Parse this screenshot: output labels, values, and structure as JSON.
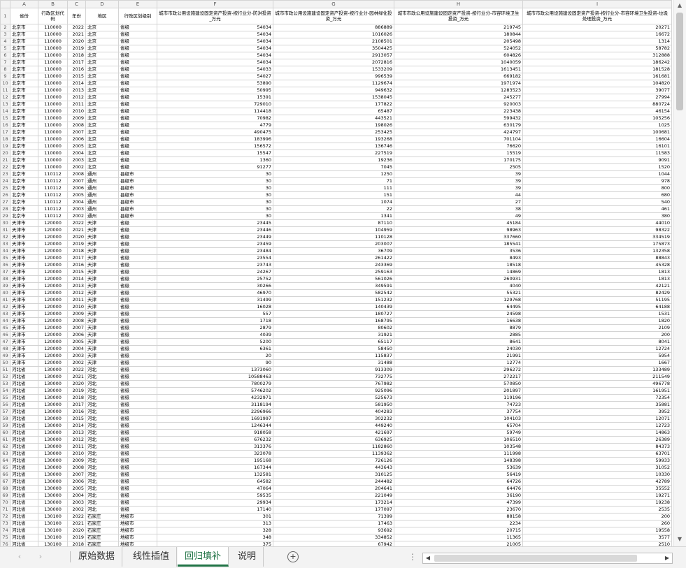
{
  "columns": [
    "A",
    "B",
    "C",
    "D",
    "E",
    "F",
    "G",
    "H",
    "I"
  ],
  "headers": [
    "省份",
    "行政区划代码",
    "年份",
    "地区",
    "行政区划级别",
    "城市市政公用设施建设固定资产投资-按行业分-防洪投资_万元",
    "城市市政公用设施建设固定资产投资-按行业分-园林绿化投资_万元",
    "城市市政公用设施建设固定资产投资-按行业分-市容环境卫生投资_万元",
    "城市市政公用设施建设固定资产投资-按行业分-市容环境卫生投资-垃圾处理投资_万元"
  ],
  "rows": [
    [
      "北京市",
      "110000",
      "2022",
      "北京",
      "省级",
      "54034",
      "886889",
      "219745",
      "20271"
    ],
    [
      "北京市",
      "110000",
      "2021",
      "北京",
      "省级",
      "54034",
      "1016026",
      "180844",
      "16672"
    ],
    [
      "北京市",
      "110000",
      "2020",
      "北京",
      "省级",
      "54034",
      "2108501",
      "205498",
      "1314"
    ],
    [
      "北京市",
      "110000",
      "2019",
      "北京",
      "省级",
      "54034",
      "3504425",
      "524052",
      "58782"
    ],
    [
      "北京市",
      "110000",
      "2018",
      "北京",
      "省级",
      "54034",
      "2913057",
      "604826",
      "312888"
    ],
    [
      "北京市",
      "110000",
      "2017",
      "北京",
      "省级",
      "54034",
      "2072816",
      "1040059",
      "186242"
    ],
    [
      "北京市",
      "110000",
      "2016",
      "北京",
      "省级",
      "54033",
      "1533209",
      "1613451",
      "181528"
    ],
    [
      "北京市",
      "110000",
      "2015",
      "北京",
      "省级",
      "54027",
      "996539",
      "669182",
      "161681"
    ],
    [
      "北京市",
      "110000",
      "2014",
      "北京",
      "省级",
      "53890",
      "1129674",
      "1971974",
      "104820"
    ],
    [
      "北京市",
      "110000",
      "2013",
      "北京",
      "省级",
      "50995",
      "949632",
      "1283523",
      "39077"
    ],
    [
      "北京市",
      "110000",
      "2012",
      "北京",
      "省级",
      "15391",
      "1538045",
      "245277",
      "27994"
    ],
    [
      "北京市",
      "110000",
      "2011",
      "北京",
      "省级",
      "729010",
      "177822",
      "920003",
      "880724"
    ],
    [
      "北京市",
      "110000",
      "2010",
      "北京",
      "省级",
      "114418",
      "65487",
      "223438",
      "46154"
    ],
    [
      "北京市",
      "110000",
      "2009",
      "北京",
      "省级",
      "70982",
      "443521",
      "599432",
      "105256"
    ],
    [
      "北京市",
      "110000",
      "2008",
      "北京",
      "省级",
      "4779",
      "198026",
      "630179",
      "1025"
    ],
    [
      "北京市",
      "110000",
      "2007",
      "北京",
      "省级",
      "490475",
      "253425",
      "424797",
      "100681"
    ],
    [
      "北京市",
      "110000",
      "2006",
      "北京",
      "省级",
      "183996",
      "193268",
      "701104",
      "16604"
    ],
    [
      "北京市",
      "110000",
      "2005",
      "北京",
      "省级",
      "156572",
      "136746",
      "76620",
      "16101"
    ],
    [
      "北京市",
      "110000",
      "2004",
      "北京",
      "省级",
      "15547",
      "227519",
      "15519",
      "11583"
    ],
    [
      "北京市",
      "110000",
      "2003",
      "北京",
      "省级",
      "1360",
      "19236",
      "170175",
      "9091"
    ],
    [
      "北京市",
      "110000",
      "2002",
      "北京",
      "省级",
      "91277",
      "7045",
      "2505",
      "1520"
    ],
    [
      "北京市",
      "110112",
      "2008",
      "通州",
      "县级市",
      "30",
      "1250",
      "39",
      "1044"
    ],
    [
      "北京市",
      "110112",
      "2007",
      "通州",
      "县级市",
      "30",
      "71",
      "39",
      "978"
    ],
    [
      "北京市",
      "110112",
      "2006",
      "通州",
      "县级市",
      "30",
      "111",
      "39",
      "800"
    ],
    [
      "北京市",
      "110112",
      "2005",
      "通州",
      "县级市",
      "30",
      "151",
      "44",
      "680"
    ],
    [
      "北京市",
      "110112",
      "2004",
      "通州",
      "县级市",
      "30",
      "1074",
      "27",
      "540"
    ],
    [
      "北京市",
      "110112",
      "2003",
      "通州",
      "县级市",
      "30",
      "22",
      "38",
      "461"
    ],
    [
      "北京市",
      "110112",
      "2002",
      "通州",
      "县级市",
      "30",
      "1341",
      "49",
      "380"
    ],
    [
      "天津市",
      "120000",
      "2022",
      "天津",
      "省级",
      "23445",
      "87110",
      "45184",
      "44010"
    ],
    [
      "天津市",
      "120000",
      "2021",
      "天津",
      "省级",
      "23446",
      "104959",
      "98963",
      "98322"
    ],
    [
      "天津市",
      "120000",
      "2020",
      "天津",
      "省级",
      "23449",
      "110128",
      "337660",
      "334519"
    ],
    [
      "天津市",
      "120000",
      "2019",
      "天津",
      "省级",
      "23459",
      "203007",
      "185541",
      "175873"
    ],
    [
      "天津市",
      "120000",
      "2018",
      "天津",
      "省级",
      "23484",
      "36709",
      "3536",
      "132358"
    ],
    [
      "天津市",
      "120000",
      "2017",
      "天津",
      "省级",
      "23554",
      "261422",
      "8493",
      "88843"
    ],
    [
      "天津市",
      "120000",
      "2016",
      "天津",
      "省级",
      "23743",
      "243369",
      "18518",
      "45328"
    ],
    [
      "天津市",
      "120000",
      "2015",
      "天津",
      "省级",
      "24267",
      "259163",
      "14869",
      "1813"
    ],
    [
      "天津市",
      "120000",
      "2014",
      "天津",
      "省级",
      "25752",
      "561026",
      "260931",
      "1813"
    ],
    [
      "天津市",
      "120000",
      "2013",
      "天津",
      "省级",
      "30266",
      "349591",
      "4040",
      "42121"
    ],
    [
      "天津市",
      "120000",
      "2012",
      "天津",
      "省级",
      "46970",
      "582542",
      "55321",
      "82429"
    ],
    [
      "天津市",
      "120000",
      "2011",
      "天津",
      "省级",
      "31499",
      "151232",
      "129768",
      "51195"
    ],
    [
      "天津市",
      "120000",
      "2010",
      "天津",
      "省级",
      "16028",
      "140439",
      "64495",
      "64188"
    ],
    [
      "天津市",
      "120000",
      "2009",
      "天津",
      "省级",
      "557",
      "180727",
      "24598",
      "1531"
    ],
    [
      "天津市",
      "120000",
      "2008",
      "天津",
      "省级",
      "1718",
      "168795",
      "16638",
      "1820"
    ],
    [
      "天津市",
      "120000",
      "2007",
      "天津",
      "省级",
      "2879",
      "80602",
      "8879",
      "2109"
    ],
    [
      "天津市",
      "120000",
      "2006",
      "天津",
      "省级",
      "4039",
      "31921",
      "2885",
      "200"
    ],
    [
      "天津市",
      "120000",
      "2005",
      "天津",
      "省级",
      "5200",
      "65117",
      "8641",
      "8041"
    ],
    [
      "天津市",
      "120000",
      "2004",
      "天津",
      "省级",
      "6361",
      "58450",
      "24030",
      "12724"
    ],
    [
      "天津市",
      "120000",
      "2003",
      "天津",
      "省级",
      "20",
      "115837",
      "21991",
      "5954"
    ],
    [
      "天津市",
      "120000",
      "2002",
      "天津",
      "省级",
      "90",
      "31488",
      "12774",
      "1667"
    ],
    [
      "河北省",
      "130000",
      "2022",
      "河北",
      "省级",
      "1373060",
      "913309",
      "296272",
      "133489"
    ],
    [
      "河北省",
      "130000",
      "2021",
      "河北",
      "省级",
      "10588463",
      "732775",
      "272217",
      "211549"
    ],
    [
      "河北省",
      "130000",
      "2020",
      "河北",
      "省级",
      "7800279",
      "767982",
      "570850",
      "496778"
    ],
    [
      "河北省",
      "130000",
      "2019",
      "河北",
      "省级",
      "5746202",
      "925096",
      "201897",
      "161951"
    ],
    [
      "河北省",
      "130000",
      "2018",
      "河北",
      "省级",
      "4232971",
      "525673",
      "119196",
      "72354"
    ],
    [
      "河北省",
      "130000",
      "2017",
      "河北",
      "省级",
      "3118194",
      "581950",
      "74723",
      "35881"
    ],
    [
      "河北省",
      "130000",
      "2016",
      "河北",
      "省级",
      "2296966",
      "404283",
      "37754",
      "3952"
    ],
    [
      "河北省",
      "130000",
      "2015",
      "河北",
      "省级",
      "1691997",
      "302232",
      "104103",
      "12071"
    ],
    [
      "河北省",
      "130000",
      "2014",
      "河北",
      "省级",
      "1246344",
      "449240",
      "65704",
      "12723"
    ],
    [
      "河北省",
      "130000",
      "2013",
      "河北",
      "省级",
      "918058",
      "421697",
      "59749",
      "14863"
    ],
    [
      "河北省",
      "130000",
      "2012",
      "河北",
      "省级",
      "676232",
      "636925",
      "106510",
      "26389"
    ],
    [
      "河北省",
      "130000",
      "2011",
      "河北",
      "省级",
      "313376",
      "1182860",
      "103548",
      "84373"
    ],
    [
      "河北省",
      "130000",
      "2010",
      "河北",
      "省级",
      "323078",
      "1139362",
      "111998",
      "63701"
    ],
    [
      "河北省",
      "130000",
      "2009",
      "河北",
      "省级",
      "195168",
      "726126",
      "148398",
      "59933"
    ],
    [
      "河北省",
      "130000",
      "2008",
      "河北",
      "省级",
      "167344",
      "443643",
      "53639",
      "31052"
    ],
    [
      "河北省",
      "130000",
      "2007",
      "河北",
      "省级",
      "132581",
      "310125",
      "56419",
      "10330"
    ],
    [
      "河北省",
      "130000",
      "2006",
      "河北",
      "省级",
      "64582",
      "244482",
      "64726",
      "42789"
    ],
    [
      "河北省",
      "130000",
      "2005",
      "河北",
      "省级",
      "47064",
      "204641",
      "64476",
      "35552"
    ],
    [
      "河北省",
      "130000",
      "2004",
      "河北",
      "省级",
      "59535",
      "221049",
      "36190",
      "19271"
    ],
    [
      "河北省",
      "130000",
      "2003",
      "河北",
      "省级",
      "29934",
      "173214",
      "47399",
      "19238"
    ],
    [
      "河北省",
      "130000",
      "2002",
      "河北",
      "省级",
      "17140",
      "177097",
      "23670",
      "2535"
    ],
    [
      "河北省",
      "130100",
      "2022",
      "石家庄",
      "地级市",
      "301",
      "71399",
      "88158",
      "200"
    ],
    [
      "河北省",
      "130100",
      "2021",
      "石家庄",
      "地级市",
      "313",
      "17463",
      "2234",
      "260"
    ],
    [
      "河北省",
      "130100",
      "2020",
      "石家庄",
      "地级市",
      "328",
      "93692",
      "20715",
      "19558"
    ],
    [
      "河北省",
      "130100",
      "2019",
      "石家庄",
      "地级市",
      "348",
      "334852",
      "11365",
      "3577"
    ],
    [
      "河北省",
      "130100",
      "2018",
      "石家庄",
      "地级市",
      "375",
      "67942",
      "21005",
      "2510"
    ]
  ],
  "sheet_tabs": [
    "原始数据",
    "线性插值",
    "回归填补",
    "说明"
  ],
  "active_tab_index": 2,
  "icons": {
    "prev_sheet": "chevron-left-icon",
    "next_sheet": "chevron-right-icon",
    "add_sheet": "plus-circle-icon",
    "scroll_up": "triangle-up-icon",
    "scroll_down": "triangle-down-icon",
    "scroll_left": "triangle-left-icon",
    "scroll_right": "triangle-right-icon"
  },
  "colors": {
    "accent": "#217346",
    "header_bg": "#f3f3f3",
    "grid": "#d4d4d4"
  }
}
